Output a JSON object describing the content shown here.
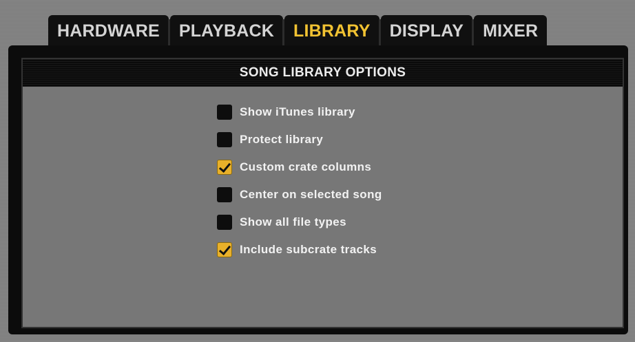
{
  "tabs": [
    {
      "label": "HARDWARE",
      "active": false
    },
    {
      "label": "PLAYBACK",
      "active": false
    },
    {
      "label": "LIBRARY",
      "active": true
    },
    {
      "label": "DISPLAY",
      "active": false
    },
    {
      "label": "MIXER",
      "active": false
    }
  ],
  "panel": {
    "title": "SONG LIBRARY OPTIONS"
  },
  "options": [
    {
      "label": "Show iTunes library",
      "checked": false
    },
    {
      "label": "Protect library",
      "checked": false
    },
    {
      "label": "Custom crate columns",
      "checked": true
    },
    {
      "label": "Center on selected song",
      "checked": false
    },
    {
      "label": "Show all file types",
      "checked": false
    },
    {
      "label": "Include subcrate tracks",
      "checked": true
    }
  ],
  "colors": {
    "accent": "#f1c232",
    "checkbox_checked": "#e8b02a",
    "panel_bg": "#777777",
    "header_bg": "#111111"
  }
}
